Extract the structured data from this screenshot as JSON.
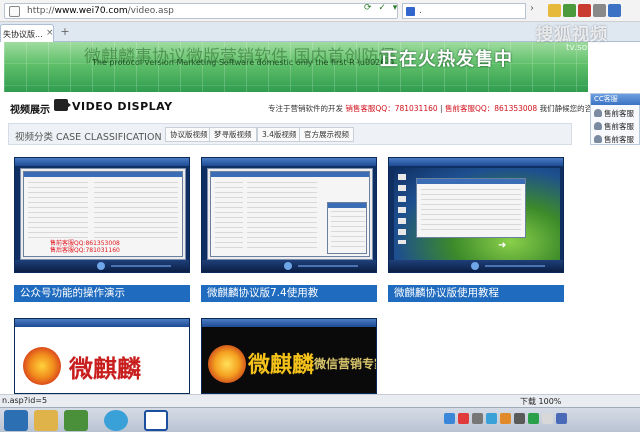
{
  "browser": {
    "url_prefix": "http://",
    "url_domain": "www.wei70.com",
    "url_path": "/video.asp",
    "search_text": ".",
    "tab_label": "失协议版...",
    "tab_close": "×",
    "new_tab": "+",
    "search_go": "›"
  },
  "banner": {
    "top_text": "微麒麟事协议微版营销软件 国内首创防侵",
    "subtitle": "The protocol version Marketing Software domestic only the first R \\u0026 D",
    "headline": "正在火热发售中"
  },
  "watermark": {
    "text": "搜狐视频",
    "url": "tv.sohu.com"
  },
  "section": {
    "title_cn": "视频展示",
    "title_en": "VIDEO DISPLAY",
    "contact_prefix": "专注于营销软件的开发",
    "contact_presale": "销售客服QQ：781031160",
    "contact_sep": " | ",
    "contact_aftersale": "售前客服QQ：861353008",
    "contact_suffix": " 我们静候您的咨询！"
  },
  "categories": {
    "title": "视频分类 CASE CLASSIFICATION",
    "tabs": [
      "协议版视频",
      "梦寻版视频",
      "3.4版视频",
      "官方展示视频"
    ]
  },
  "videos": [
    {
      "caption": "公众号功能的操作演示",
      "overlay": "售前客服QQ:861353008\n售后客服QQ:781031160"
    },
    {
      "caption": "微麒麟协议版7.4使用教"
    },
    {
      "caption": "微麒麟协议版使用教程"
    },
    {
      "logo": "微麒麟"
    },
    {
      "logo": "微麒麟",
      "slogan": "微信营销专家"
    }
  ],
  "side_panel": {
    "title": "CC客服",
    "items": [
      "售前客服",
      "售前客服",
      "售前客服"
    ]
  },
  "statusbar": {
    "left": "n.asp?id=5",
    "right": "下载    100%"
  },
  "colors": {
    "caption_bg": "#1f6bbf",
    "banner_green": "#5fbf6a",
    "contact_red": "#d0111b"
  }
}
